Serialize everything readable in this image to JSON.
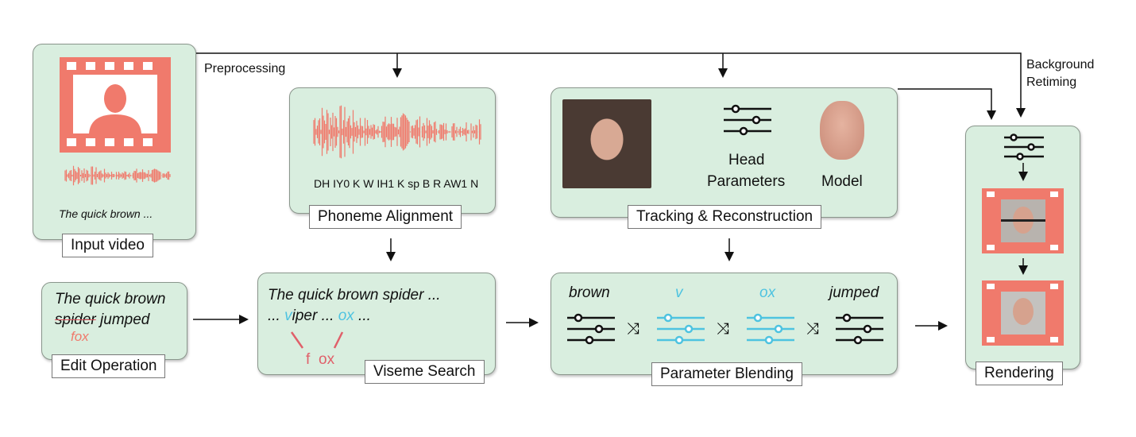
{
  "labels": {
    "input_video": "Input video",
    "phoneme_alignment": "Phoneme Alignment",
    "tracking": "Tracking & Reconstruction",
    "rendering": "Rendering",
    "edit_operation": "Edit Operation",
    "viseme_search": "Viseme Search",
    "parameter_blending": "Parameter Blending"
  },
  "flow": {
    "preprocessing": "Preprocessing",
    "background_retiming_1": "Background",
    "background_retiming_2": "Retiming"
  },
  "input": {
    "transcript": "The quick brown ..."
  },
  "phoneme": {
    "sequence": "DH IY0 K W IH1 K sp B R AW1 N"
  },
  "tracking": {
    "head_params_1": "Head",
    "head_params_2": "Parameters",
    "model": "Model"
  },
  "edit": {
    "line1": "The quick brown",
    "struck": "spider",
    "rest": " jumped",
    "replacement": "fox"
  },
  "viseme": {
    "line1": "The quick brown spider ...",
    "pre": "... ",
    "v": "v",
    "iper": "iper ... ",
    "ox": "ox",
    "post": " ...",
    "f": "f",
    "ox2": "ox"
  },
  "blending": {
    "w1": "brown",
    "w2": "v",
    "w3": "ox",
    "w4": "jumped"
  },
  "colors": {
    "box": "#d9eedf",
    "accent": "#f07a6c",
    "cyan": "#4ec3e0"
  }
}
